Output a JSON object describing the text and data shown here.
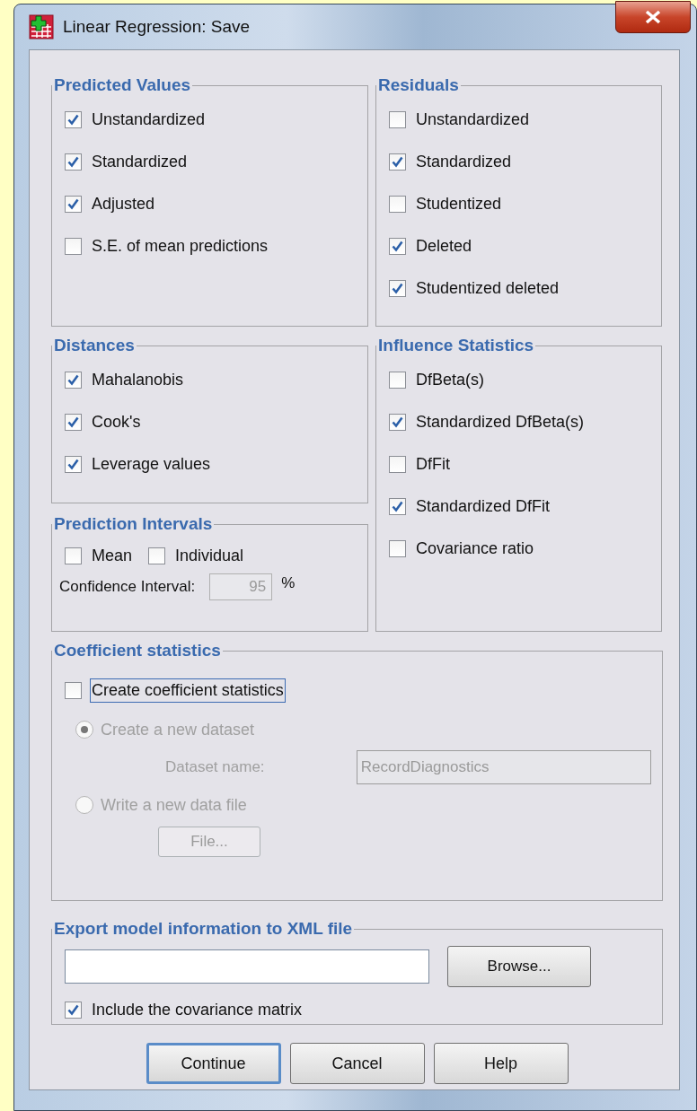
{
  "window": {
    "title": "Linear Regression: Save"
  },
  "predicted_values": {
    "title": "Predicted Values",
    "items": [
      {
        "label": "Unstandardized",
        "checked": true
      },
      {
        "label": "Standardized",
        "checked": true
      },
      {
        "label": "Adjusted",
        "checked": true
      },
      {
        "label": "S.E. of mean predictions",
        "checked": false
      }
    ]
  },
  "residuals": {
    "title": "Residuals",
    "items": [
      {
        "label": "Unstandardized",
        "checked": false
      },
      {
        "label": "Standardized",
        "checked": true
      },
      {
        "label": "Studentized",
        "checked": false
      },
      {
        "label": "Deleted",
        "checked": true
      },
      {
        "label": "Studentized deleted",
        "checked": true
      }
    ]
  },
  "distances": {
    "title": "Distances",
    "items": [
      {
        "label": "Mahalanobis",
        "checked": true
      },
      {
        "label": "Cook's",
        "checked": true
      },
      {
        "label": "Leverage values",
        "checked": true
      }
    ]
  },
  "prediction_intervals": {
    "title": "Prediction Intervals",
    "items": [
      {
        "label": "Mean",
        "checked": false
      },
      {
        "label": "Individual",
        "checked": false
      }
    ],
    "confidence_interval": {
      "label": "Confidence Interval:",
      "value": "95",
      "unit": "%",
      "disabled": true
    }
  },
  "influence_statistics": {
    "title": "Influence Statistics",
    "items": [
      {
        "label": "DfBeta(s)",
        "checked": false
      },
      {
        "label": "Standardized DfBeta(s)",
        "checked": true
      },
      {
        "label": "DfFit",
        "checked": false
      },
      {
        "label": "Standardized DfFit",
        "checked": true
      },
      {
        "label": "Covariance ratio",
        "checked": false
      }
    ]
  },
  "coefficient_statistics": {
    "title": "Coefficient statistics",
    "create": {
      "label": "Create coefficient statistics",
      "checked": false,
      "focused": true
    },
    "options": [
      {
        "label": "Create a new dataset",
        "selected": true,
        "disabled": true
      },
      {
        "label": "Write a new data file",
        "selected": false,
        "disabled": true
      }
    ],
    "dataset_name": {
      "label": "Dataset name:",
      "value": "RecordDiagnostics",
      "disabled": true
    },
    "file_button": {
      "label": "File...",
      "disabled": true
    }
  },
  "export_xml": {
    "title": "Export model information to XML file",
    "browse_button": {
      "label": "Browse..."
    },
    "include_covariance": {
      "label": "Include the covariance matrix",
      "checked": true
    }
  },
  "buttons": [
    {
      "label": "Continue",
      "default": true
    },
    {
      "label": "Cancel",
      "default": false
    },
    {
      "label": "Help",
      "default": false
    }
  ]
}
